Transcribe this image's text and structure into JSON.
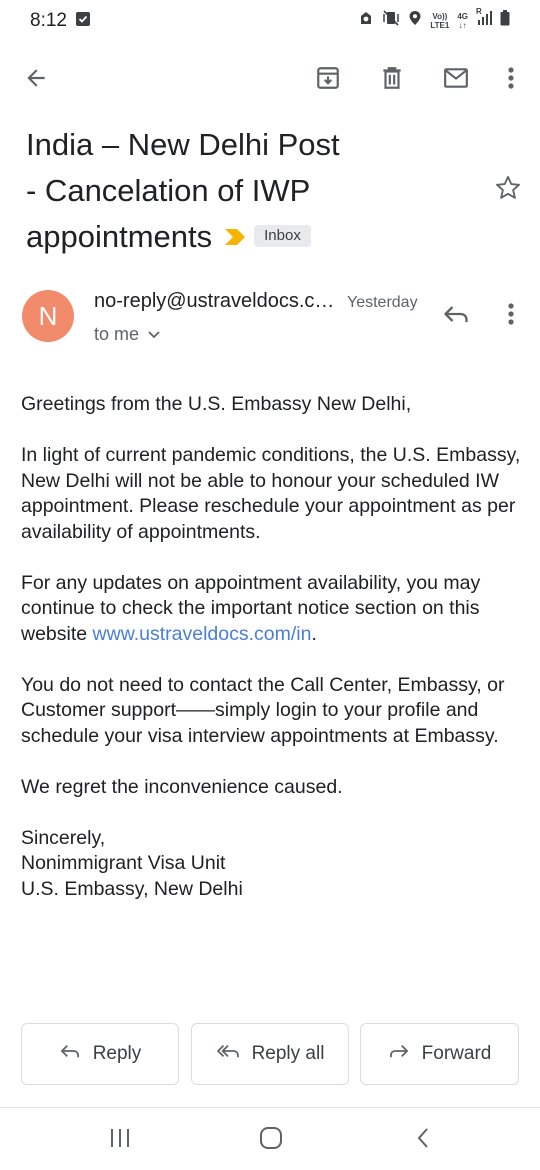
{
  "status_bar": {
    "time": "8:12",
    "net_volte": "Vo))",
    "net_lte": "LTE1",
    "net_4g": "4G",
    "net_arrows": "↓↑",
    "net_roaming": "R"
  },
  "toolbar": {
    "back_icon": "arrow-back-icon",
    "archive_icon": "archive-icon",
    "delete_icon": "delete-icon",
    "mark_unread_icon": "mail-icon",
    "more_icon": "more-vert-icon"
  },
  "email": {
    "subject_line1": "India – New Delhi Post",
    "subject_line2": "- Cancelation of IWP",
    "subject_line3": "appointments",
    "label": "Inbox",
    "sender_initial": "N",
    "sender_name": "no-reply@ustraveldocs.com",
    "date": "Yesterday",
    "recipient": "to me",
    "body": {
      "greeting": "Greetings from the U.S. Embassy  New Delhi,",
      "p1": "In light of current pandemic conditions, the U.S. Embassy, New Delhi will not be able to honour your scheduled IW appointment. Please reschedule your appointment as per availability of appointments.",
      "p2_text": "For any updates on appointment availability, you may continue to check the important notice section on this website ",
      "p2_link": "www.ustraveldocs.com/in",
      "p2_end": ".",
      "p3": "You do not need to contact the Call Center, Embassy, or Customer support——simply login to your profile and schedule your visa interview appointments at Embassy.",
      "p4": "We regret the inconvenience caused.",
      "sign1": "Sincerely,",
      "sign2": "Nonimmigrant Visa Unit",
      "sign3": "U.S. Embassy, New Delhi"
    }
  },
  "actions": {
    "reply": "Reply",
    "reply_all": "Reply all",
    "forward": "Forward"
  },
  "colors": {
    "avatar": "#f28b6c",
    "importance": "#f4b400",
    "link": "#4a7ed8",
    "text": "#202124",
    "secondary": "#5f6368"
  }
}
